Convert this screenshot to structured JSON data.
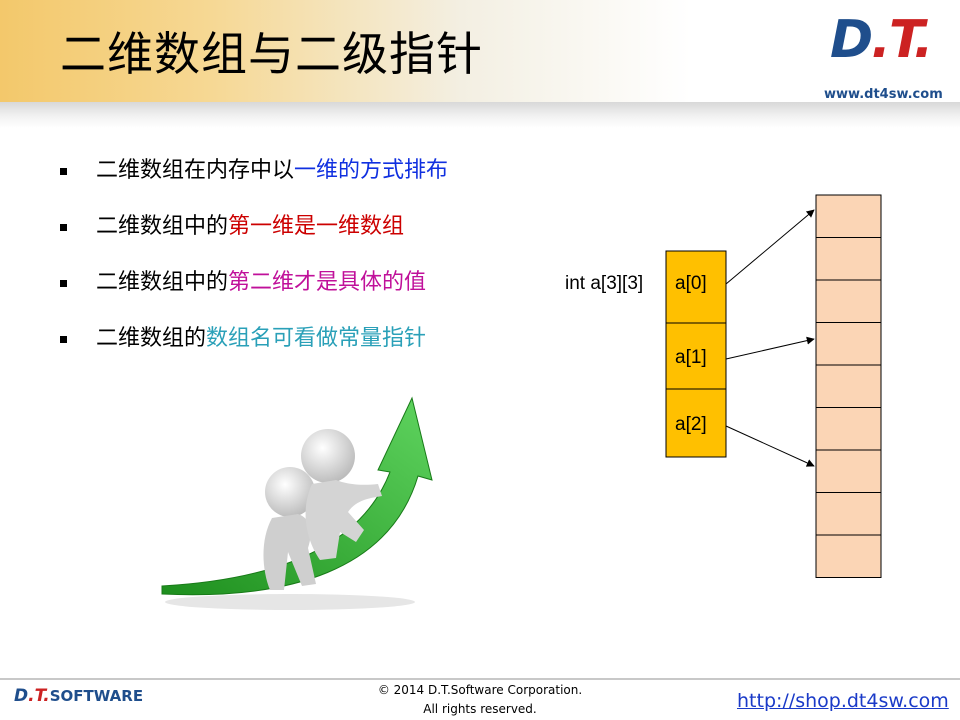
{
  "header": {
    "title": "二维数组与二级指针",
    "logo_text": "D.T.",
    "website": "www.dt4sw.com"
  },
  "bullets": [
    {
      "segments": [
        {
          "text": "二维数组在内存中以",
          "color": "black"
        },
        {
          "text": "一维的方式排布",
          "color": "blue"
        }
      ]
    },
    {
      "segments": [
        {
          "text": "二维数组中的",
          "color": "black"
        },
        {
          "text": "第一维是一维数组",
          "color": "red"
        }
      ]
    },
    {
      "segments": [
        {
          "text": "二维数组中的",
          "color": "black"
        },
        {
          "text": "第二维才是具体的值",
          "color": "magenta"
        }
      ]
    },
    {
      "segments": [
        {
          "text": "二维数组的",
          "color": "black"
        },
        {
          "text": "数组名可看做常量指针",
          "color": "teal"
        }
      ]
    }
  ],
  "diagram": {
    "declaration": "int a[3][3]",
    "rows": [
      "a[0]",
      "a[1]",
      "a[2]"
    ],
    "memory_cell_count": 9,
    "row_fill": "#ffc000",
    "cell_fill": "#fbd5b5"
  },
  "footer": {
    "logo_text": "D.T.",
    "logo_suffix": "SOFTWARE",
    "copyright_line1": "© 2014 D.T.Software Corporation.",
    "copyright_line2": "All rights reserved.",
    "url": "http://shop.dt4sw.com"
  }
}
